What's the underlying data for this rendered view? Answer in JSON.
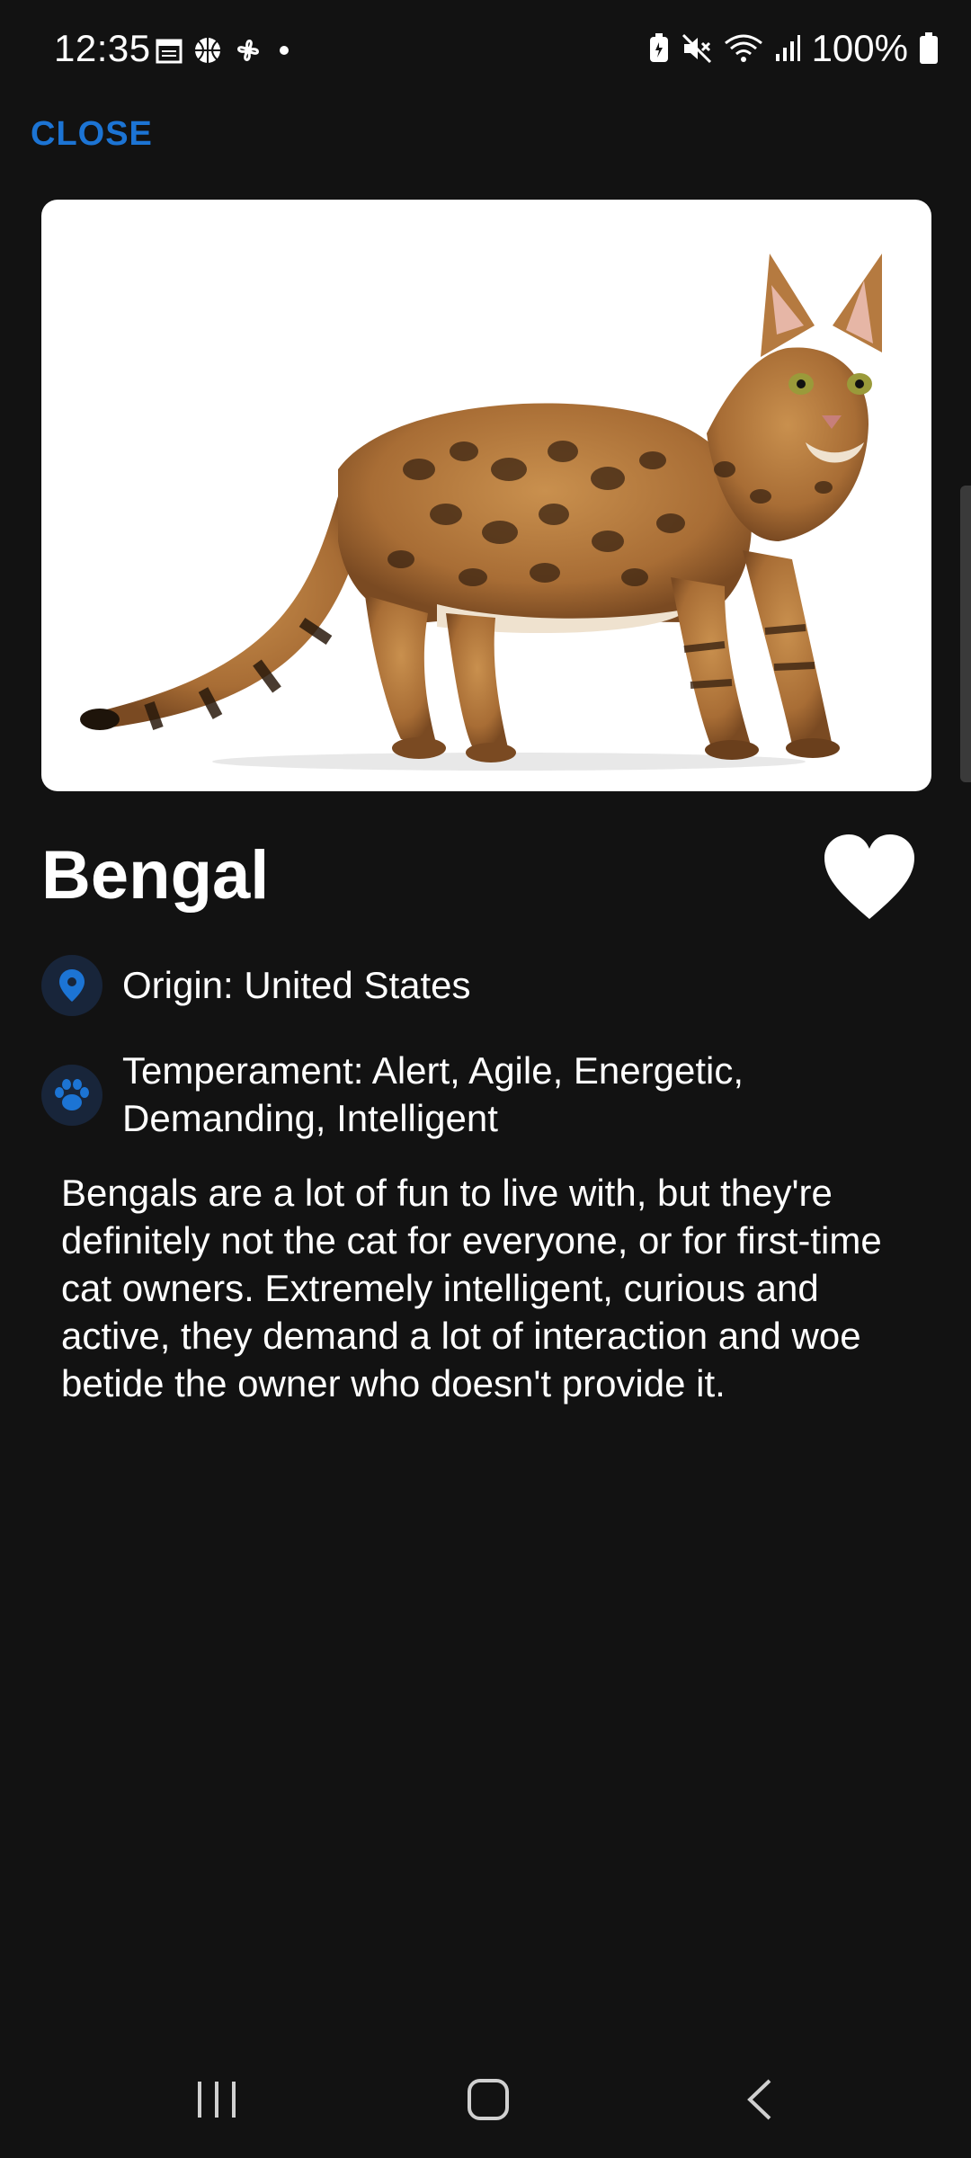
{
  "status_bar": {
    "time": "12:35",
    "battery": "100%",
    "left_icons": [
      "calendar-icon",
      "basketball-icon",
      "pinwheel-icon",
      "dot-icon"
    ],
    "right_icons": [
      "battery-saver-icon",
      "mute-icon",
      "wifi-icon",
      "signal-icon",
      "battery-icon"
    ]
  },
  "header": {
    "close_label": "CLOSE"
  },
  "breed": {
    "name": "Bengal",
    "image_icon": "bengal-cat-photo",
    "favorite_icon": "heart-icon",
    "origin": "Origin: United States",
    "origin_icon": "location-pin-icon",
    "temperament": "Temperament: Alert, Agile, Energetic, Demanding, Intelligent",
    "temperament_icon": "paw-icon",
    "description": "Bengals are a lot of fun to live with, but they're definitely not the cat for everyone, or for first-time cat owners. Extremely intelligent, curious and active, they demand a lot of interaction and woe betide the owner who doesn't provide it."
  },
  "colors": {
    "background": "#121212",
    "accent": "#1c74d4",
    "icon_bg": "#18253a",
    "text": "#ffffff"
  },
  "nav": {
    "icons": [
      "recent-apps-icon",
      "home-icon",
      "back-icon"
    ]
  }
}
